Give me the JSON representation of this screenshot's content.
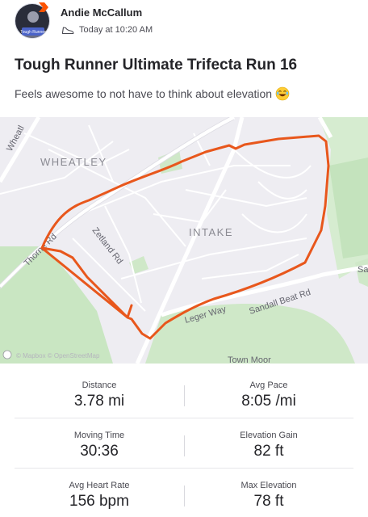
{
  "athlete": {
    "name": "Andie McCallum",
    "timestamp": "Today at 10:20 AM",
    "avatar_text": "Tough Runner"
  },
  "activity": {
    "title": "Tough Runner Ultimate Trifecta Run 16",
    "description": "Feels awesome to not have to think about elevation"
  },
  "map": {
    "labels": {
      "wheatley": "WHEATLEY",
      "intake": "INTAKE",
      "zetland_rd": "Zetland Rd",
      "thorne_rd": "Thorne Rd",
      "wheatley_road": "Wheatl",
      "sandall_beat_rd": "Sandall Beat Rd",
      "leger_way": "Leger Way",
      "town_moor": "Town Moor",
      "edge_label": "Sa",
      "attribution": "© Mapbox © OpenStreetMap"
    },
    "route_color": "#e8571c"
  },
  "stats": [
    [
      {
        "label": "Distance",
        "value": "3.78 mi"
      },
      {
        "label": "Avg Pace",
        "value": "8:05 /mi"
      }
    ],
    [
      {
        "label": "Moving Time",
        "value": "30:36"
      },
      {
        "label": "Elevation Gain",
        "value": "82 ft"
      }
    ],
    [
      {
        "label": "Avg Heart Rate",
        "value": "156 bpm"
      },
      {
        "label": "Max Elevation",
        "value": "78 ft"
      }
    ]
  ]
}
